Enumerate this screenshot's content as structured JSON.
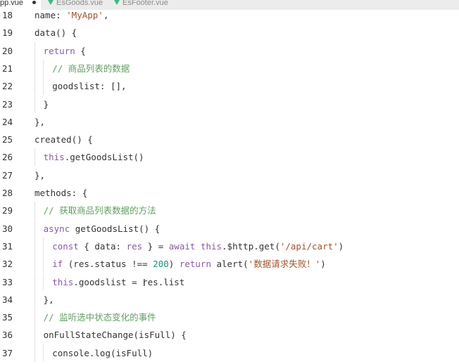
{
  "tabs": [
    {
      "label": "pp.vue",
      "modified": true,
      "active": true
    },
    {
      "label": "EsGoods.vue",
      "modified": false,
      "active": false
    },
    {
      "label": "EsFooter.vue",
      "modified": false,
      "active": false
    }
  ],
  "code_lines": [
    {
      "n": "18",
      "indent": 0,
      "tokens": [
        [
          "prop",
          "name: "
        ],
        [
          "str",
          "'MyApp'"
        ],
        [
          "prop",
          ","
        ]
      ]
    },
    {
      "n": "19",
      "indent": 0,
      "tokens": [
        [
          "fn",
          "data() {"
        ]
      ]
    },
    {
      "n": "20",
      "indent": 1,
      "tokens": [
        [
          "kw",
          "return"
        ],
        [
          "prop",
          " {"
        ]
      ]
    },
    {
      "n": "21",
      "indent": 2,
      "tokens": [
        [
          "cmt",
          "// 商品列表的数据"
        ]
      ]
    },
    {
      "n": "22",
      "indent": 2,
      "tokens": [
        [
          "prop",
          "goodslist: [],"
        ]
      ]
    },
    {
      "n": "23",
      "indent": 1,
      "tokens": [
        [
          "prop",
          "}"
        ]
      ]
    },
    {
      "n": "24",
      "indent": 0,
      "tokens": [
        [
          "prop",
          "},"
        ]
      ]
    },
    {
      "n": "25",
      "indent": 0,
      "tokens": [
        [
          "fn",
          "created() {"
        ]
      ]
    },
    {
      "n": "26",
      "indent": 1,
      "tokens": [
        [
          "kw",
          "this"
        ],
        [
          "fn",
          ".getGoodsList()"
        ]
      ]
    },
    {
      "n": "27",
      "indent": 0,
      "tokens": [
        [
          "prop",
          "},"
        ]
      ]
    },
    {
      "n": "28",
      "indent": 0,
      "tokens": [
        [
          "prop",
          "methods: {"
        ]
      ]
    },
    {
      "n": "29",
      "indent": 1,
      "tokens": [
        [
          "cmt",
          "// 获取商品列表数据的方法"
        ]
      ]
    },
    {
      "n": "30",
      "indent": 1,
      "tokens": [
        [
          "kw",
          "async"
        ],
        [
          "fn",
          " getGoodsList() {"
        ]
      ]
    },
    {
      "n": "31",
      "indent": 2,
      "tokens": [
        [
          "kw",
          "const"
        ],
        [
          "prop",
          " { data: "
        ],
        [
          "kw",
          "res"
        ],
        [
          "prop",
          " } = "
        ],
        [
          "kw",
          "await"
        ],
        [
          "prop",
          " "
        ],
        [
          "kw",
          "this"
        ],
        [
          "fn",
          ".$http.get("
        ],
        [
          "str",
          "'/api/cart'"
        ],
        [
          "prop",
          ")"
        ]
      ]
    },
    {
      "n": "32",
      "indent": 2,
      "tokens": [
        [
          "kw",
          "if"
        ],
        [
          "prop",
          " (res.status !== "
        ],
        [
          "num",
          "200"
        ],
        [
          "prop",
          ") "
        ],
        [
          "kw",
          "return"
        ],
        [
          "fn",
          " alert("
        ],
        [
          "str",
          "'数据请求失败！'"
        ],
        [
          "prop",
          ")"
        ]
      ]
    },
    {
      "n": "33",
      "indent": 2,
      "tokens": [
        [
          "kw",
          "this"
        ],
        [
          "prop",
          ".goodslist = res.list"
        ]
      ]
    },
    {
      "n": "34",
      "indent": 1,
      "tokens": [
        [
          "prop",
          "},"
        ]
      ]
    },
    {
      "n": "35",
      "indent": 1,
      "tokens": [
        [
          "cmt",
          "// 监听选中状态变化的事件"
        ]
      ]
    },
    {
      "n": "36",
      "indent": 1,
      "tokens": [
        [
          "fn",
          "onFullStateChange(isFull) {"
        ]
      ]
    },
    {
      "n": "37",
      "indent": 2,
      "tokens": [
        [
          "fn",
          "console.log(isFull)"
        ]
      ]
    }
  ],
  "text_cursor": "I"
}
